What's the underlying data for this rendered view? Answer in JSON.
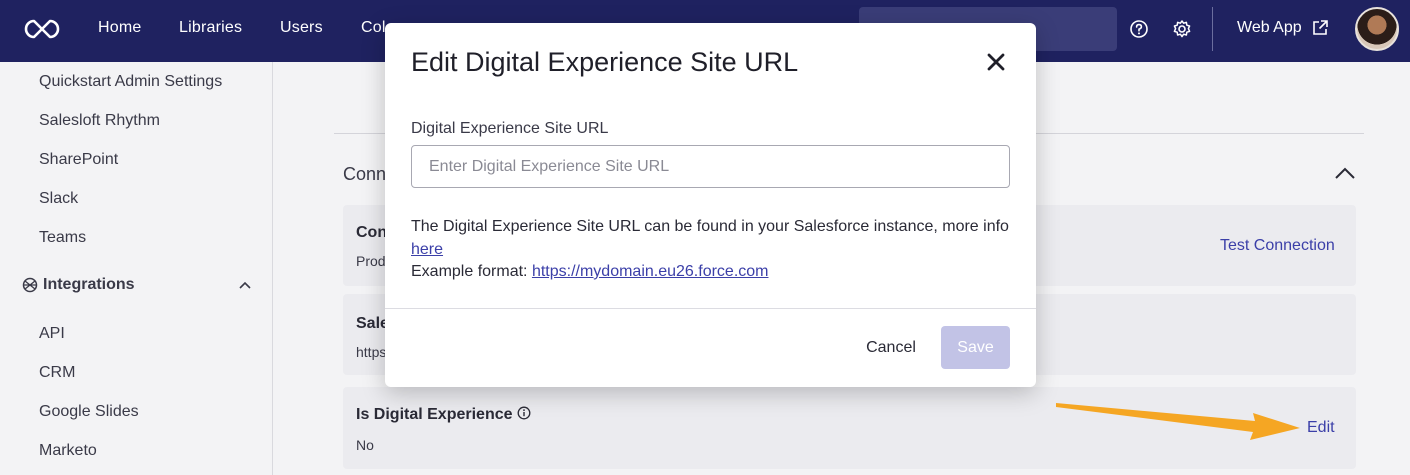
{
  "nav": {
    "links": [
      "Home",
      "Libraries",
      "Users",
      "Col"
    ],
    "web_app_label": "Web App"
  },
  "sidebar": {
    "items_top": [
      "Quickstart Admin Settings",
      "Salesloft Rhythm",
      "SharePoint",
      "Slack",
      "Teams"
    ],
    "section_label": "Integrations",
    "items_bottom": [
      "API",
      "CRM",
      "Google Slides",
      "Marketo"
    ]
  },
  "main": {
    "section_title": "Conn",
    "cards": [
      {
        "title": "Con",
        "value": "Prod",
        "link": "Test Connection"
      },
      {
        "title": "Sale",
        "value": "https"
      },
      {
        "title": "Is Digital Experience",
        "value": "No",
        "link": "Edit"
      }
    ]
  },
  "modal": {
    "title": "Edit Digital Experience Site URL",
    "field_label": "Digital Experience Site URL",
    "input_value": "",
    "input_placeholder": "Enter Digital Experience Site URL",
    "help_text": "The Digital Experience Site URL can be found in your Salesforce instance, more info",
    "help_link": "here",
    "example_label": "Example format:",
    "example_link": "https://mydomain.eu26.force.com",
    "cancel_label": "Cancel",
    "save_label": "Save"
  },
  "colors": {
    "nav_bg": "#1f2260",
    "link": "#3b3fa8",
    "save_disabled": "#c2c3e6",
    "arrow": "#f5a623"
  }
}
